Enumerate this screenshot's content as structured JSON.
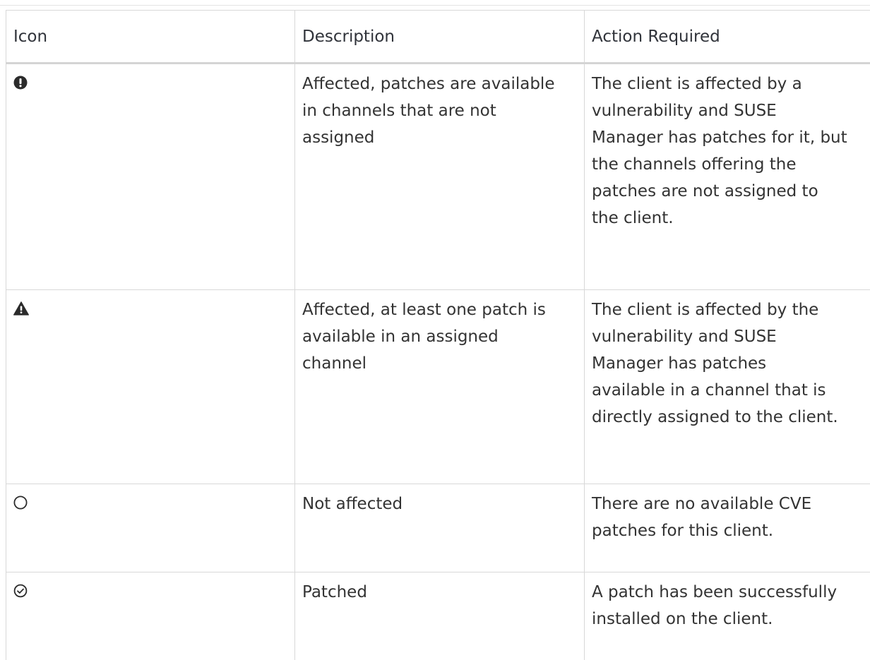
{
  "table": {
    "headers": [
      "Icon",
      "Description",
      "Action Required"
    ],
    "rows": [
      {
        "icon": "exclamation-circle-icon",
        "description_lines": [
          "Affected, patches are available",
          "in channels that are not",
          "assigned"
        ],
        "action_lines": [
          "The client is affected by a",
          "vulnerability and SUSE",
          "Manager has patches for it, but",
          "the channels offering the",
          "patches are not assigned to",
          "the client."
        ]
      },
      {
        "icon": "warning-triangle-icon",
        "description_lines": [
          "Affected, at least one patch is",
          "available in an assigned",
          "channel"
        ],
        "action_lines": [
          "The client is affected by the",
          "vulnerability and SUSE",
          "Manager has patches",
          "available in a channel that is",
          "directly assigned to the client."
        ]
      },
      {
        "icon": "empty-circle-icon",
        "description_lines": [
          "Not affected"
        ],
        "action_lines": [
          "There are no available CVE",
          "patches for this client."
        ]
      },
      {
        "icon": "check-circle-icon",
        "description_lines": [
          "Patched"
        ],
        "action_lines": [
          "A patch has been successfully",
          "installed on the client."
        ]
      }
    ]
  },
  "colors": {
    "text": "#333333",
    "border": "#d8d8d8",
    "icon": "#2b2b2b"
  }
}
